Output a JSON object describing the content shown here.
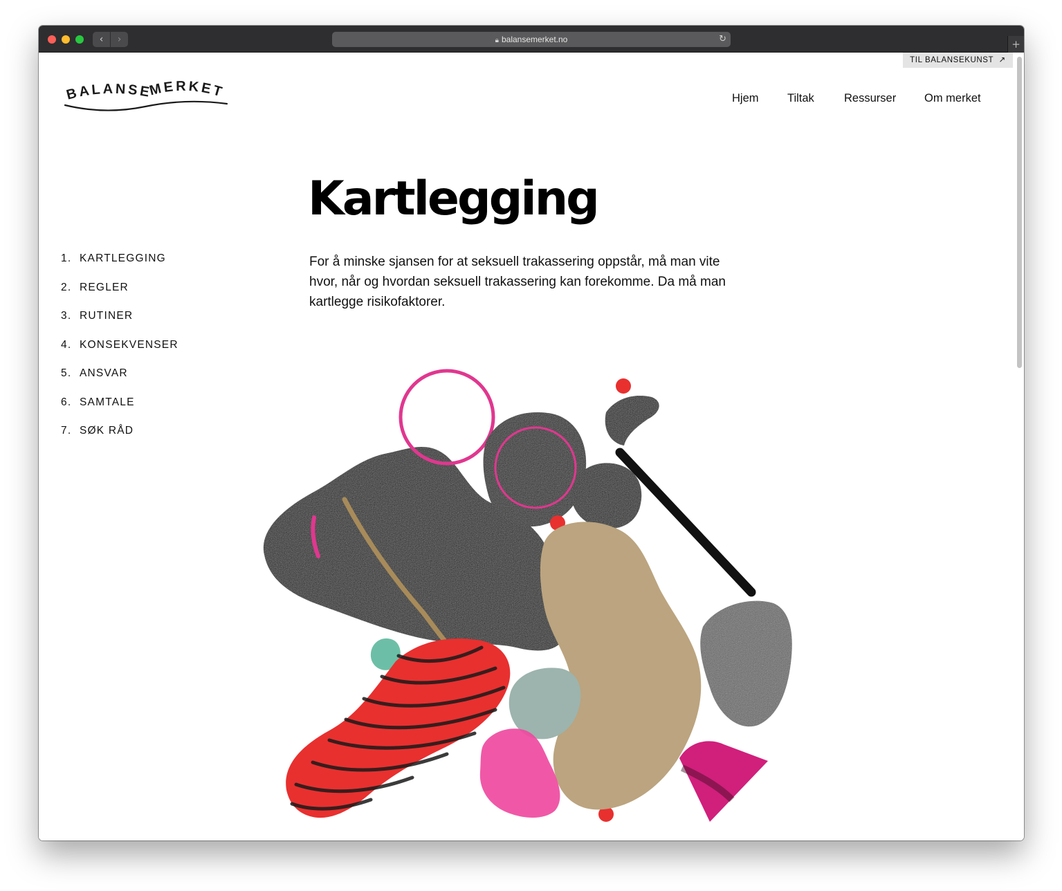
{
  "browser": {
    "url": "balansemerket.no"
  },
  "top_link": {
    "label": "TIL BALANSEKUNST",
    "icon": "arrow-up-right-icon"
  },
  "logo": {
    "word1": "BALANSE",
    "word2": "MERKET"
  },
  "main_nav": [
    "Hjem",
    "Tiltak",
    "Ressurser",
    "Om merket"
  ],
  "side_nav": [
    {
      "num": "1.",
      "label": "KARTLEGGING"
    },
    {
      "num": "2.",
      "label": "REGLER"
    },
    {
      "num": "3.",
      "label": "RUTINER"
    },
    {
      "num": "4.",
      "label": "KONSEKVENSER"
    },
    {
      "num": "5.",
      "label": "ANSVAR"
    },
    {
      "num": "6.",
      "label": "SAMTALE"
    },
    {
      "num": "7.",
      "label": "SØK RÅD"
    }
  ],
  "page": {
    "title": "Kartlegging",
    "intro": "For å minske sjansen for at seksuell trakassering oppstår, må man vite hvor, når og hvordan seksuell trakassering kan forekomme. Da må man kartlegge risikofaktorer."
  },
  "colors": {
    "text": "#111111",
    "accent_red": "#e8302f",
    "accent_pink": "#e0378f",
    "beige": "#bba47f",
    "teal": "#6cbfa6",
    "sage": "#9cb4ad"
  }
}
